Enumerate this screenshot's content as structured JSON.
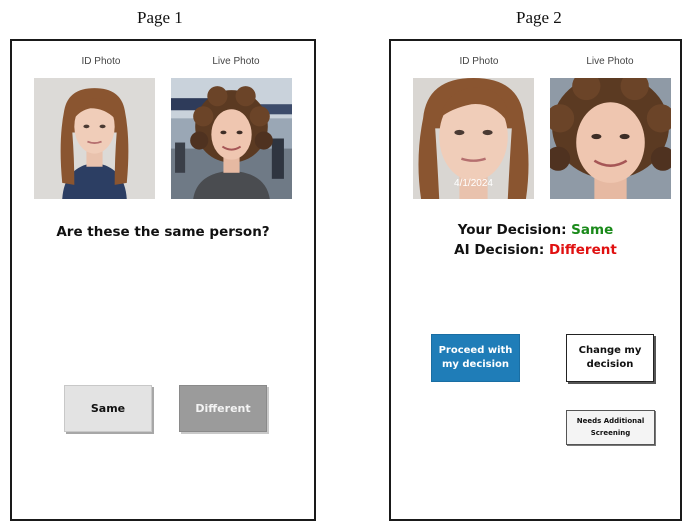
{
  "page1": {
    "label": "Page 1",
    "id_photo_caption": "ID Photo",
    "live_photo_caption": "Live Photo",
    "question": "Are these the same person?",
    "same_button": "Same",
    "different_button": "Different"
  },
  "page2": {
    "label": "Page 2",
    "id_photo_caption": "ID Photo",
    "live_photo_caption": "Live Photo",
    "id_photo_date": "4/1/2024",
    "your_decision_label": "Your Decision:",
    "your_decision_value": "Same",
    "ai_decision_label": "AI Decision:",
    "ai_decision_value": "Different",
    "proceed_button": "Proceed with my decision",
    "change_button": "Change my decision",
    "screening_button": "Needs Additional Screening"
  },
  "colors": {
    "same_text": "#1a8a1a",
    "different_text": "#e01010",
    "proceed_bg": "#1f7db8"
  },
  "icons": {
    "id_photo": "woman-long-hair-portrait",
    "live_photo": "woman-curly-hair-portrait"
  }
}
